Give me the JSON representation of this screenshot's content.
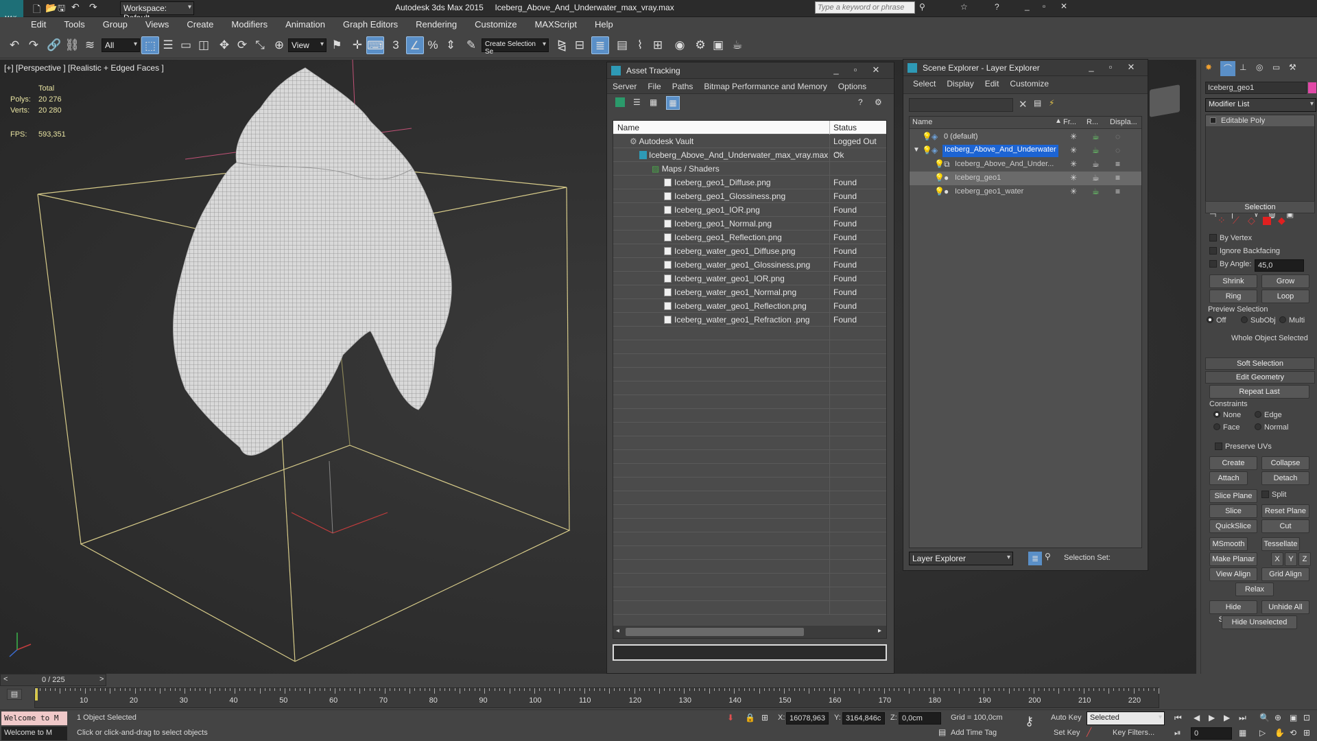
{
  "app": {
    "title": "Autodesk 3ds Max 2015",
    "file": "Iceberg_Above_And_Underwater_max_vray.max",
    "logo": "MAX"
  },
  "titlebar": {
    "workspace": "Workspace: Default",
    "search_placeholder": "Type a keyword or phrase"
  },
  "menu": [
    "Edit",
    "Tools",
    "Group",
    "Views",
    "Create",
    "Modifiers",
    "Animation",
    "Graph Editors",
    "Rendering",
    "Customize",
    "MAXScript",
    "Help"
  ],
  "toolbar": {
    "filter": "All",
    "coord": "View",
    "selection_set": "Create Selection Se"
  },
  "viewport": {
    "label": "[+] [Perspective ] [Realistic + Edged Faces ]",
    "total_label": "Total",
    "polys_label": "Polys:",
    "polys": "20 276",
    "verts_label": "Verts:",
    "verts": "20 280",
    "fps_label": "FPS:",
    "fps": "593,351"
  },
  "asset_tracking": {
    "title": "Asset Tracking",
    "menu": [
      "Server",
      "File",
      "Paths",
      "Bitmap Performance and Memory",
      "Options"
    ],
    "columns": {
      "name": "Name",
      "status": "Status"
    },
    "rows": [
      {
        "name": "Autodesk Vault",
        "status": "Logged Out ..."
      },
      {
        "name": "Iceberg_Above_And_Underwater_max_vray.max",
        "status": "Ok"
      },
      {
        "name": "Maps / Shaders",
        "status": ""
      },
      {
        "name": "Iceberg_geo1_Diffuse.png",
        "status": "Found"
      },
      {
        "name": "Iceberg_geo1_Glossiness.png",
        "status": "Found"
      },
      {
        "name": "Iceberg_geo1_IOR.png",
        "status": "Found"
      },
      {
        "name": "Iceberg_geo1_Normal.png",
        "status": "Found"
      },
      {
        "name": "Iceberg_geo1_Reflection.png",
        "status": "Found"
      },
      {
        "name": "Iceberg_water_geo1_Diffuse.png",
        "status": "Found"
      },
      {
        "name": "Iceberg_water_geo1_Glossiness.png",
        "status": "Found"
      },
      {
        "name": "Iceberg_water_geo1_IOR.png",
        "status": "Found"
      },
      {
        "name": "Iceberg_water_geo1_Normal.png",
        "status": "Found"
      },
      {
        "name": "Iceberg_water_geo1_Reflection.png",
        "status": "Found"
      },
      {
        "name": "Iceberg_water_geo1_Refraction .png",
        "status": "Found"
      }
    ]
  },
  "scene_explorer": {
    "title": "Scene Explorer - Layer Explorer",
    "menu": [
      "Select",
      "Display",
      "Edit",
      "Customize"
    ],
    "columns": {
      "name": "Name",
      "frozen": "Fr...",
      "render": "R...",
      "display": "Displa..."
    },
    "rows": [
      {
        "name": "0 (default)"
      },
      {
        "name": "Iceberg_Above_And_Underwater"
      },
      {
        "name": "Iceberg_Above_And_Under..."
      },
      {
        "name": "Iceberg_geo1"
      },
      {
        "name": "Iceberg_geo1_water"
      }
    ],
    "footer_dropdown": "Layer Explorer",
    "selection_set_label": "Selection Set:"
  },
  "command_panel": {
    "object_name": "Iceberg_geo1",
    "modifier_list": "Modifier List",
    "stack_item": "Editable Poly",
    "selection_title": "Selection",
    "by_vertex": "By Vertex",
    "ignore_backfacing": "Ignore Backfacing",
    "by_angle": "By Angle:",
    "angle_value": "45,0",
    "shrink": "Shrink",
    "grow": "Grow",
    "ring": "Ring",
    "loop": "Loop",
    "preview_selection": "Preview Selection",
    "preview_options": [
      "Off",
      "SubObj",
      "Multi"
    ],
    "whole_object_selected": "Whole Object Selected",
    "soft_selection": "Soft Selection",
    "edit_geometry": "Edit Geometry",
    "repeat_last": "Repeat Last",
    "constraints": "Constraints",
    "constraint_options": [
      "None",
      "Edge",
      "Face",
      "Normal"
    ],
    "preserve_uvs": "Preserve UVs",
    "create": "Create",
    "collapse": "Collapse",
    "attach": "Attach",
    "detach": "Detach",
    "slice_plane": "Slice Plane",
    "split": "Split",
    "slice": "Slice",
    "reset_plane": "Reset Plane",
    "quickslice": "QuickSlice",
    "cut": "Cut",
    "msmooth": "MSmooth",
    "tessellate": "Tessellate",
    "make_planar": "Make Planar",
    "x": "X",
    "y": "Y",
    "z": "Z",
    "view_align": "View Align",
    "grid_align": "Grid Align",
    "relax": "Relax",
    "hide_selected": "Hide Selected",
    "unhide_all": "Unhide All",
    "hide_unselected": "Hide Unselected"
  },
  "timeline": {
    "frame": "0 / 225",
    "ticks": [
      "10",
      "20",
      "30",
      "40",
      "50",
      "60",
      "70",
      "80",
      "90",
      "100",
      "110",
      "120",
      "130",
      "140",
      "150",
      "160",
      "170",
      "180",
      "190",
      "200",
      "210",
      "220"
    ]
  },
  "status": {
    "welcome": "Welcome to M",
    "objects_selected": "1 Object Selected",
    "prompt": "Click or click-and-drag to select objects",
    "x_label": "X:",
    "x": "16078,963",
    "y_label": "Y:",
    "y": "3164,846c",
    "z_label": "Z:",
    "z": "0,0cm",
    "grid": "Grid = 100,0cm",
    "add_time_tag": "Add Time Tag",
    "auto_key": "Auto Key",
    "key_mode": "Selected",
    "set_key": "Set Key",
    "key_filters": "Key Filters...",
    "frame_field": "0"
  }
}
